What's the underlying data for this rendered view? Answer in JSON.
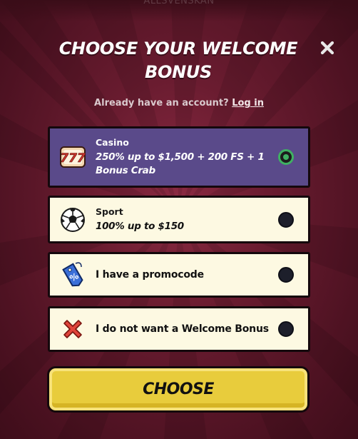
{
  "background": {
    "top_text": "ALLSVENSKAN"
  },
  "modal": {
    "title": "CHOOSE YOUR WELCOME BONUS",
    "account_prompt": "Already have an account?",
    "login_link": "Log in",
    "close_icon": "close-icon"
  },
  "options": [
    {
      "label": "Casino",
      "description": "250% up to $1,500 + 200 FS + 1 Bonus Crab",
      "icon": "slot-777-icon",
      "selected": true
    },
    {
      "label": "Sport",
      "description": "100% up to $150",
      "icon": "soccer-ball-icon",
      "selected": false
    },
    {
      "label": "I have a promocode",
      "icon": "percent-tag-icon",
      "selected": false
    },
    {
      "label": "I do not want a Welcome Bonus",
      "icon": "red-x-icon",
      "selected": false
    }
  ],
  "choose_button": {
    "label": "CHOOSE"
  },
  "colors": {
    "background": "#6a1c30",
    "selected_option": "#5a4a8a",
    "option": "#fdf9e2",
    "radio_checked": "#3fb162",
    "button": "#e8cc3c"
  }
}
